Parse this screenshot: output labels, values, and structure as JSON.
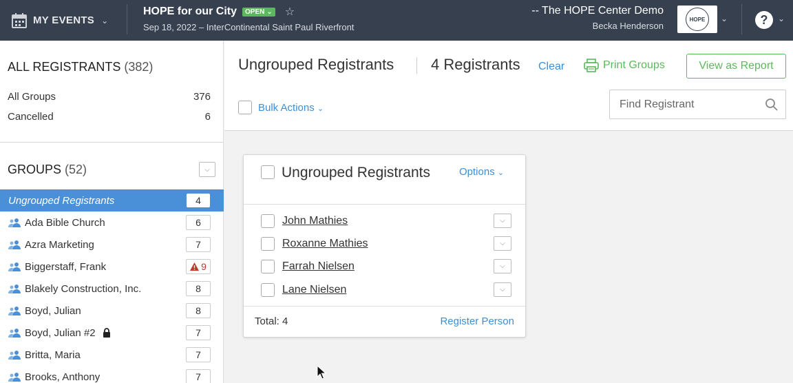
{
  "topbar": {
    "my_events_label": "MY EVENTS",
    "event_title": "HOPE for our City",
    "event_status": "OPEN",
    "event_subtitle": "Sep 18, 2022 – InterContinental Saint Paul Riverfront",
    "org_name": "-- The HOPE Center Demo",
    "user_name": "Becka Henderson",
    "logo_text": "HOPE",
    "help_label": "?"
  },
  "sidebar": {
    "all_registrants_label": "ALL REGISTRANTS",
    "all_registrants_count": "(382)",
    "summary": [
      {
        "label": "All Groups",
        "count": "376"
      },
      {
        "label": "Cancelled",
        "count": "6"
      }
    ],
    "groups_label": "GROUPS",
    "groups_count": "(52)",
    "groups": [
      {
        "name": "Ungrouped Registrants",
        "count": "4",
        "active": true
      },
      {
        "name": "Ada Bible Church",
        "count": "6"
      },
      {
        "name": "Azra Marketing",
        "count": "7"
      },
      {
        "name": "Biggerstaff, Frank",
        "count": "9",
        "warning": true
      },
      {
        "name": "Blakely Construction, Inc.",
        "count": "8"
      },
      {
        "name": "Boyd, Julian",
        "count": "8"
      },
      {
        "name": "Boyd, Julian #2",
        "count": "7",
        "locked": true
      },
      {
        "name": "Britta, Maria",
        "count": "7"
      },
      {
        "name": "Brooks, Anthony",
        "count": "7"
      }
    ]
  },
  "main": {
    "title": "Ungrouped Registrants",
    "count_label": "4 Registrants",
    "clear_label": "Clear",
    "print_label": "Print Groups",
    "report_label": "View as Report",
    "bulk_label": "Bulk Actions",
    "search_placeholder": "Find Registrant"
  },
  "card": {
    "title": "Ungrouped Registrants",
    "options_label": "Options",
    "registrants": [
      "John Mathies",
      "Roxanne Mathies",
      "Farrah Nielsen",
      "Lane Nielsen"
    ],
    "total_label": "Total: 4",
    "register_label": "Register Person"
  },
  "colors": {
    "topbar": "#37404f",
    "accent_blue": "#3a8fd6",
    "active_row": "#4a90d9",
    "green": "#5cb85c",
    "warning_red": "#c0392b"
  }
}
